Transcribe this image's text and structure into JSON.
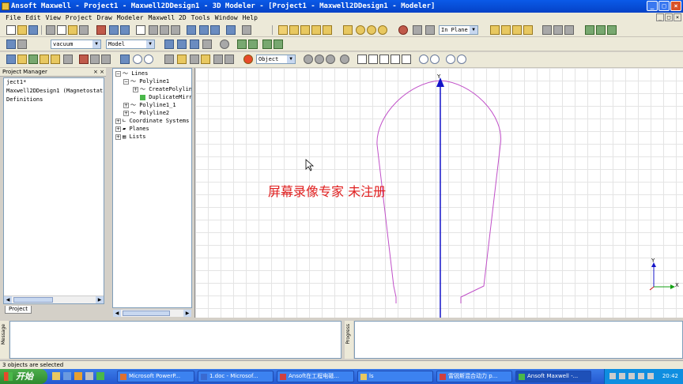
{
  "window": {
    "title": "Ansoft Maxwell - Project1 - Maxwell2DDesign1 - 3D Modeler - [Project1 - Maxwell2DDesign1 - Modeler]"
  },
  "menu": [
    "File",
    "Edit",
    "View",
    "Project",
    "Draw",
    "Modeler",
    "Maxwell 2D",
    "Tools",
    "Window",
    "Help"
  ],
  "toolbar": {
    "plane_select": "In Plane",
    "material_select": "vacuum",
    "model_select": "Model",
    "filter_select": "Object"
  },
  "project_manager": {
    "title": "Project Manager",
    "lines": [
      "ject1*",
      "Maxwell2DDesign1 (Magnetostatic,",
      "Definitions"
    ],
    "tab": "Project"
  },
  "tree": {
    "items": [
      "Lines",
      "Polyline1",
      "CreatePolyline",
      "DuplicateMirror",
      "Polyline1_1",
      "Polyline2",
      "Coordinate Systems",
      "Planes",
      "Lists"
    ]
  },
  "canvas": {
    "axis_label": "Y",
    "watermark": "屏幕录像专家 未注册",
    "triad_x": "X",
    "triad_y": "Y"
  },
  "bottom": {
    "messages_label": "Message",
    "progress_label": "Progress"
  },
  "status": {
    "text": "3 objects are selected"
  },
  "taskbar": {
    "start": "开始",
    "tasks": [
      "Microsoft PowerP...",
      "1.doc - Microsof...",
      "Ansoft在工程电磁...",
      "ls",
      "雷锐斯混合动力 p...",
      "Ansoft Maxwell -..."
    ],
    "clock": "20:42"
  },
  "colors": {
    "outline": "#c050c8",
    "axis": "#1414c8",
    "watermark": "#e02020"
  }
}
